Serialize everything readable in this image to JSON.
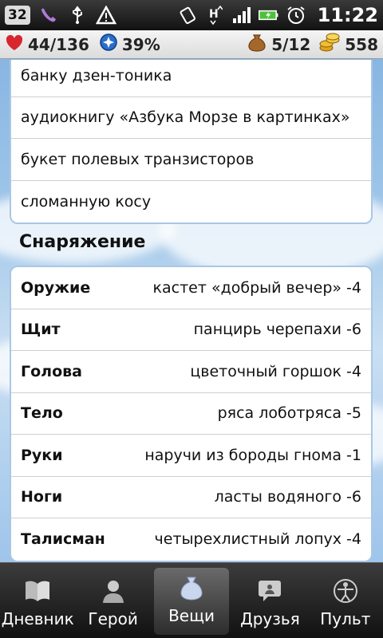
{
  "statusbar": {
    "badge": "32",
    "time": "11:22",
    "icons": [
      "voicemail-icon",
      "usb-icon",
      "warning-icon",
      "vibrate-icon",
      "network-h-icon",
      "signal-icon",
      "battery-icon",
      "alarm-icon"
    ]
  },
  "stats": {
    "health": "44/136",
    "godpower": "39%",
    "inventory": "5/12",
    "gold": "558"
  },
  "inventory_items": [
    "банку дзен-тоника",
    "аудиокнигу «Азбука Морзе в картинках»",
    "букет полевых транзисторов",
    "сломанную косу"
  ],
  "equipment": {
    "title": "Снаряжение",
    "rows": [
      {
        "slot": "Оружие",
        "item": "кастет «добрый вечер» -4"
      },
      {
        "slot": "Щит",
        "item": "панцирь черепахи -6"
      },
      {
        "slot": "Голова",
        "item": "цветочный горшок -4"
      },
      {
        "slot": "Тело",
        "item": "ряса лоботряса -5"
      },
      {
        "slot": "Руки",
        "item": "наручи из бороды гнома -1"
      },
      {
        "slot": "Ноги",
        "item": "ласты водяного -6"
      },
      {
        "slot": "Талисман",
        "item": "четырехлистный лопух -4"
      }
    ]
  },
  "tabs": [
    {
      "label": "Дневник",
      "icon": "book-icon",
      "active": false
    },
    {
      "label": "Герой",
      "icon": "hero-icon",
      "active": false
    },
    {
      "label": "Вещи",
      "icon": "bag-icon",
      "active": true
    },
    {
      "label": "Друзья",
      "icon": "chat-icon",
      "active": false
    },
    {
      "label": "Пульт",
      "icon": "vitruvian-icon",
      "active": false
    }
  ],
  "colors": {
    "health": "#d8262e",
    "godpower": "#2a6fc9",
    "gold": "#e0a41d"
  }
}
